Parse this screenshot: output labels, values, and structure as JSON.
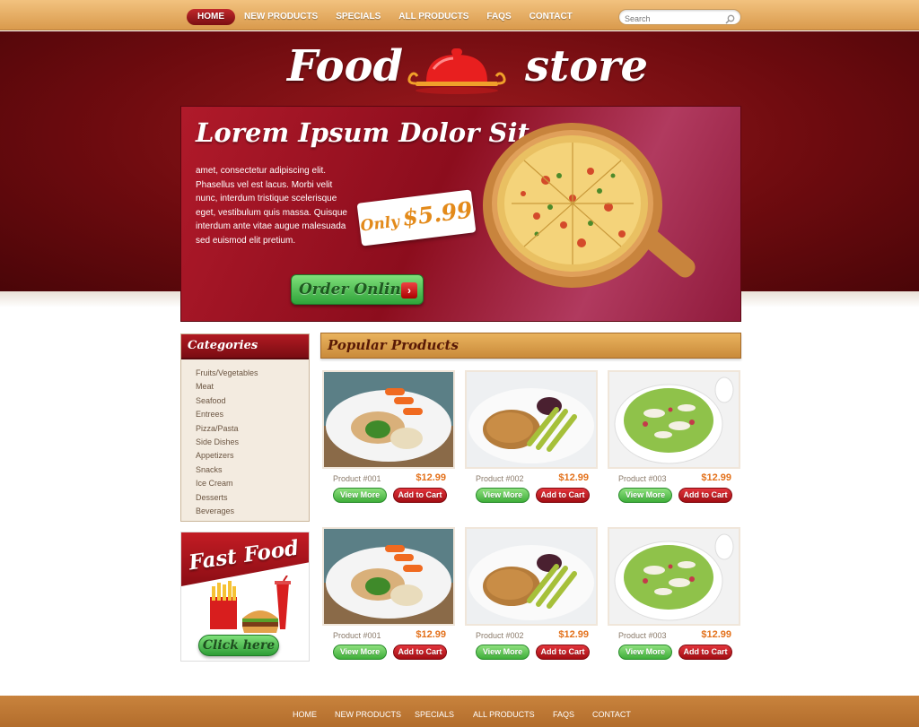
{
  "nav": {
    "items": [
      "HOME",
      "NEW PRODUCTS",
      "SPECIALS",
      "ALL PRODUCTS",
      "FAQS",
      "CONTACT"
    ],
    "active": "HOME"
  },
  "search": {
    "placeholder": "Search"
  },
  "logo": {
    "word1": "Food",
    "word2": "store"
  },
  "banner": {
    "title": "Lorem Ipsum Dolor Sit",
    "text": "amet, consectetur adipiscing elit. Phasellus vel est lacus. Morbi velit nunc, interdum tristique scelerisque eget, vestibulum quis massa. Quisque interdum ante vitae augue malesuada sed euismod elit pretium.",
    "price_prefix": "Only",
    "price": "$5.99",
    "order_label": "Order Online"
  },
  "categories": {
    "title": "Categories",
    "items": [
      "Fruits/Vegetables",
      "Meat",
      "Seafood",
      "Entrees",
      "Pizza/Pasta",
      "Side Dishes",
      "Appetizers",
      "Snacks",
      "Ice Cream",
      "Desserts",
      "Beverages"
    ]
  },
  "promo": {
    "title": "Fast Food",
    "button": "Click here"
  },
  "popular": {
    "title": "Popular Products",
    "products": [
      {
        "name": "Product #001",
        "price": "$12.99",
        "view": "View More",
        "cart": "Add to Cart"
      },
      {
        "name": "Product #002",
        "price": "$12.99",
        "view": "View More",
        "cart": "Add to Cart"
      },
      {
        "name": "Product #003",
        "price": "$12.99",
        "view": "View More",
        "cart": "Add to Cart"
      },
      {
        "name": "Product #001",
        "price": "$12.99",
        "view": "View More",
        "cart": "Add to Cart"
      },
      {
        "name": "Product #002",
        "price": "$12.99",
        "view": "View More",
        "cart": "Add to Cart"
      },
      {
        "name": "Product #003",
        "price": "$12.99",
        "view": "View More",
        "cart": "Add to Cart"
      }
    ]
  },
  "footer": {
    "items": [
      "HOME",
      "NEW PRODUCTS",
      "SPECIALS",
      "ALL PRODUCTS",
      "FAQS",
      "CONTACT"
    ]
  },
  "colors": {
    "brand_red": "#8c0d1d",
    "accent_orange": "#e3711b",
    "button_green": "#3fae3a",
    "topbar": "#d99a4c"
  }
}
